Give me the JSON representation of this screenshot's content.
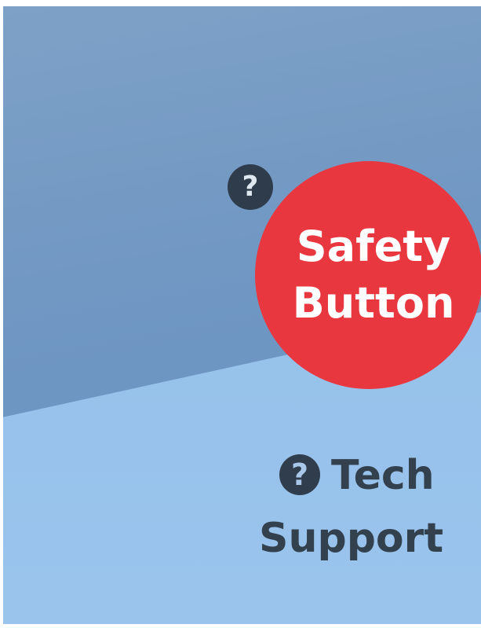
{
  "help_badge": {
    "icon": "question-circle-icon",
    "glyph": "?"
  },
  "safety_button": {
    "line1": "Safety",
    "line2": "Button",
    "color": "#e9373f"
  },
  "tech_support": {
    "icon": "question-circle-icon",
    "glyph": "?",
    "line1": "Tech",
    "line2": "Support",
    "color": "#33414f"
  },
  "colors": {
    "panel_dark": "#7198c3",
    "panel_light": "#93bee8"
  }
}
